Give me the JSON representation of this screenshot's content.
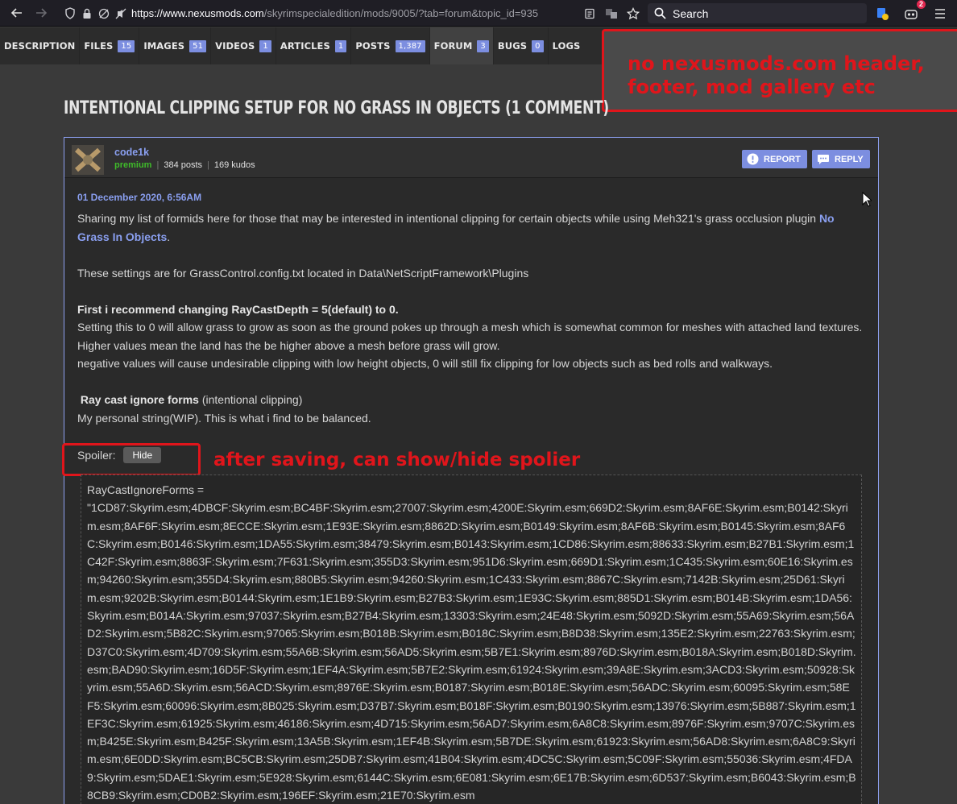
{
  "browser": {
    "url_host": "https://www.nexusmods.com",
    "url_rest": "/skyrimspecialedition/mods/9005/?tab=forum&topic_id=935",
    "search_placeholder": "Search",
    "notification_count": "2"
  },
  "tabs": [
    {
      "label": "DESCRIPTION",
      "count": ""
    },
    {
      "label": "FILES",
      "count": "15"
    },
    {
      "label": "IMAGES",
      "count": "51"
    },
    {
      "label": "VIDEOS",
      "count": "1"
    },
    {
      "label": "ARTICLES",
      "count": "1"
    },
    {
      "label": "POSTS",
      "count": "1,387"
    },
    {
      "label": "FORUM",
      "count": "3"
    },
    {
      "label": "BUGS",
      "count": "0"
    },
    {
      "label": "LOGS",
      "count": ""
    }
  ],
  "annotations": {
    "top_line1": "no nexusmods.com header,",
    "top_line2": "footer, mod gallery etc",
    "spoiler_note": "after saving, can show/hide spolier"
  },
  "topic": {
    "title": "Intentional clipping setup for No Grass In Objects (1 comment)"
  },
  "post": {
    "author": "code1k",
    "role": "premium",
    "posts": "384 posts",
    "kudos": "169 kudos",
    "report_label": "REPORT",
    "reply_label": "REPLY",
    "date": "01 December 2020, 6:56AM",
    "para1_text": "Sharing my list of formids here for those that may be interested in intentional clipping for certain objects while using Meh321's  grass occlusion plugin ",
    "para1_link": "No Grass In Objects",
    "para1_end": ".",
    "para2": "These settings are for GrassControl.config.txt located in Data\\NetScriptFramework\\Plugins",
    "para3_bold": "First i recommend changing RayCastDepth = 5(default) to 0.",
    "para3_line1": "Setting this to 0 will allow grass to grow as soon as the ground pokes up through a mesh which is somewhat common for meshes with attached land textures.",
    "para3_line2": "Higher values mean the land has the be higher above a mesh before grass will grow.",
    "para3_line3": "negative values will cause undesirable clipping with low height objects, 0 will still fix clipping for low objects such as bed rolls and walkways.",
    "para4_bold": "Ray cast ignore forms",
    "para4_rest": " (intentional clipping)",
    "para4_line2": "My personal string(WIP). This is what i find to be balanced.",
    "spoiler_label": "Spoiler:",
    "hide_label": "Hide",
    "spoiler_line1": "RayCastIgnoreForms =",
    "spoiler_code": "\"1CD87:Skyrim.esm;4DBCF:Skyrim.esm;BC4BF:Skyrim.esm;27007:Skyrim.esm;4200E:Skyrim.esm;669D2:Skyrim.esm;8AF6E:Skyrim.esm;B0142:Skyrim.esm;8AF6F:Skyrim.esm;8ECCE:Skyrim.esm;1E93E:Skyrim.esm;8862D:Skyrim.esm;B0149:Skyrim.esm;8AF6B:Skyrim.esm;B0145:Skyrim.esm;8AF6C:Skyrim.esm;B0146:Skyrim.esm;1DA55:Skyrim.esm;38479:Skyrim.esm;B0143:Skyrim.esm;1CD86:Skyrim.esm;88633:Skyrim.esm;B27B1:Skyrim.esm;1C42F:Skyrim.esm;8863F:Skyrim.esm;7F631:Skyrim.esm;355D3:Skyrim.esm;951D6:Skyrim.esm;669D1:Skyrim.esm;1C435:Skyrim.esm;60E16:Skyrim.esm;94260:Skyrim.esm;355D4:Skyrim.esm;880B5:Skyrim.esm;94260:Skyrim.esm;1C433:Skyrim.esm;8867C:Skyrim.esm;7142B:Skyrim.esm;25D61:Skyrim.esm;9202B:Skyrim.esm;B0144:Skyrim.esm;1E1B9:Skyrim.esm;B27B3:Skyrim.esm;1E93C:Skyrim.esm;885D1:Skyrim.esm;B014B:Skyrim.esm;1DA56:Skyrim.esm;B014A:Skyrim.esm;97037:Skyrim.esm;B27B4:Skyrim.esm;13303:Skyrim.esm;24E48:Skyrim.esm;5092D:Skyrim.esm;55A69:Skyrim.esm;56AD2:Skyrim.esm;5B82C:Skyrim.esm;97065:Skyrim.esm;B018B:Skyrim.esm;B018C:Skyrim.esm;B8D38:Skyrim.esm;135E2:Skyrim.esm;22763:Skyrim.esm;D37C0:Skyrim.esm;4D709:Skyrim.esm;55A6B:Skyrim.esm;56AD5:Skyrim.esm;5B7E1:Skyrim.esm;8976D:Skyrim.esm;B018A:Skyrim.esm;B018D:Skyrim.esm;BAD90:Skyrim.esm;16D5F:Skyrim.esm;1EF4A:Skyrim.esm;5B7E2:Skyrim.esm;61924:Skyrim.esm;39A8E:Skyrim.esm;3ACD3:Skyrim.esm;50928:Skyrim.esm;55A6D:Skyrim.esm;56ACD:Skyrim.esm;8976E:Skyrim.esm;B0187:Skyrim.esm;B018E:Skyrim.esm;56ADC:Skyrim.esm;60095:Skyrim.esm;58EF5:Skyrim.esm;60096:Skyrim.esm;8B025:Skyrim.esm;D37B7:Skyrim.esm;B018F:Skyrim.esm;B0190:Skyrim.esm;13976:Skyrim.esm;5B887:Skyrim.esm;1EF3C:Skyrim.esm;61925:Skyrim.esm;46186:Skyrim.esm;4D715:Skyrim.esm;56AD7:Skyrim.esm;6A8C8:Skyrim.esm;8976F:Skyrim.esm;9707C:Skyrim.esm;B425E:Skyrim.esm;B425F:Skyrim.esm;13A5B:Skyrim.esm;1EF4B:Skyrim.esm;5B7DE:Skyrim.esm;61923:Skyrim.esm;56AD8:Skyrim.esm;6A8C9:Skyrim.esm;6E0DD:Skyrim.esm;BC5CB:Skyrim.esm;25DB7:Skyrim.esm;41B04:Skyrim.esm;4DC5C:Skyrim.esm;5C09F:Skyrim.esm;55036:Skyrim.esm;4FDA9:Skyrim.esm;5DAE1:Skyrim.esm;5E928:Skyrim.esm;6144C:Skyrim.esm;6E081:Skyrim.esm;6E17B:Skyrim.esm;6D537:Skyrim.esm;B6043:Skyrim.esm;B8CB9:Skyrim.esm;CD0B2:Skyrim.esm;196EF:Skyrim.esm;21E70:Skyrim.esm"
  }
}
